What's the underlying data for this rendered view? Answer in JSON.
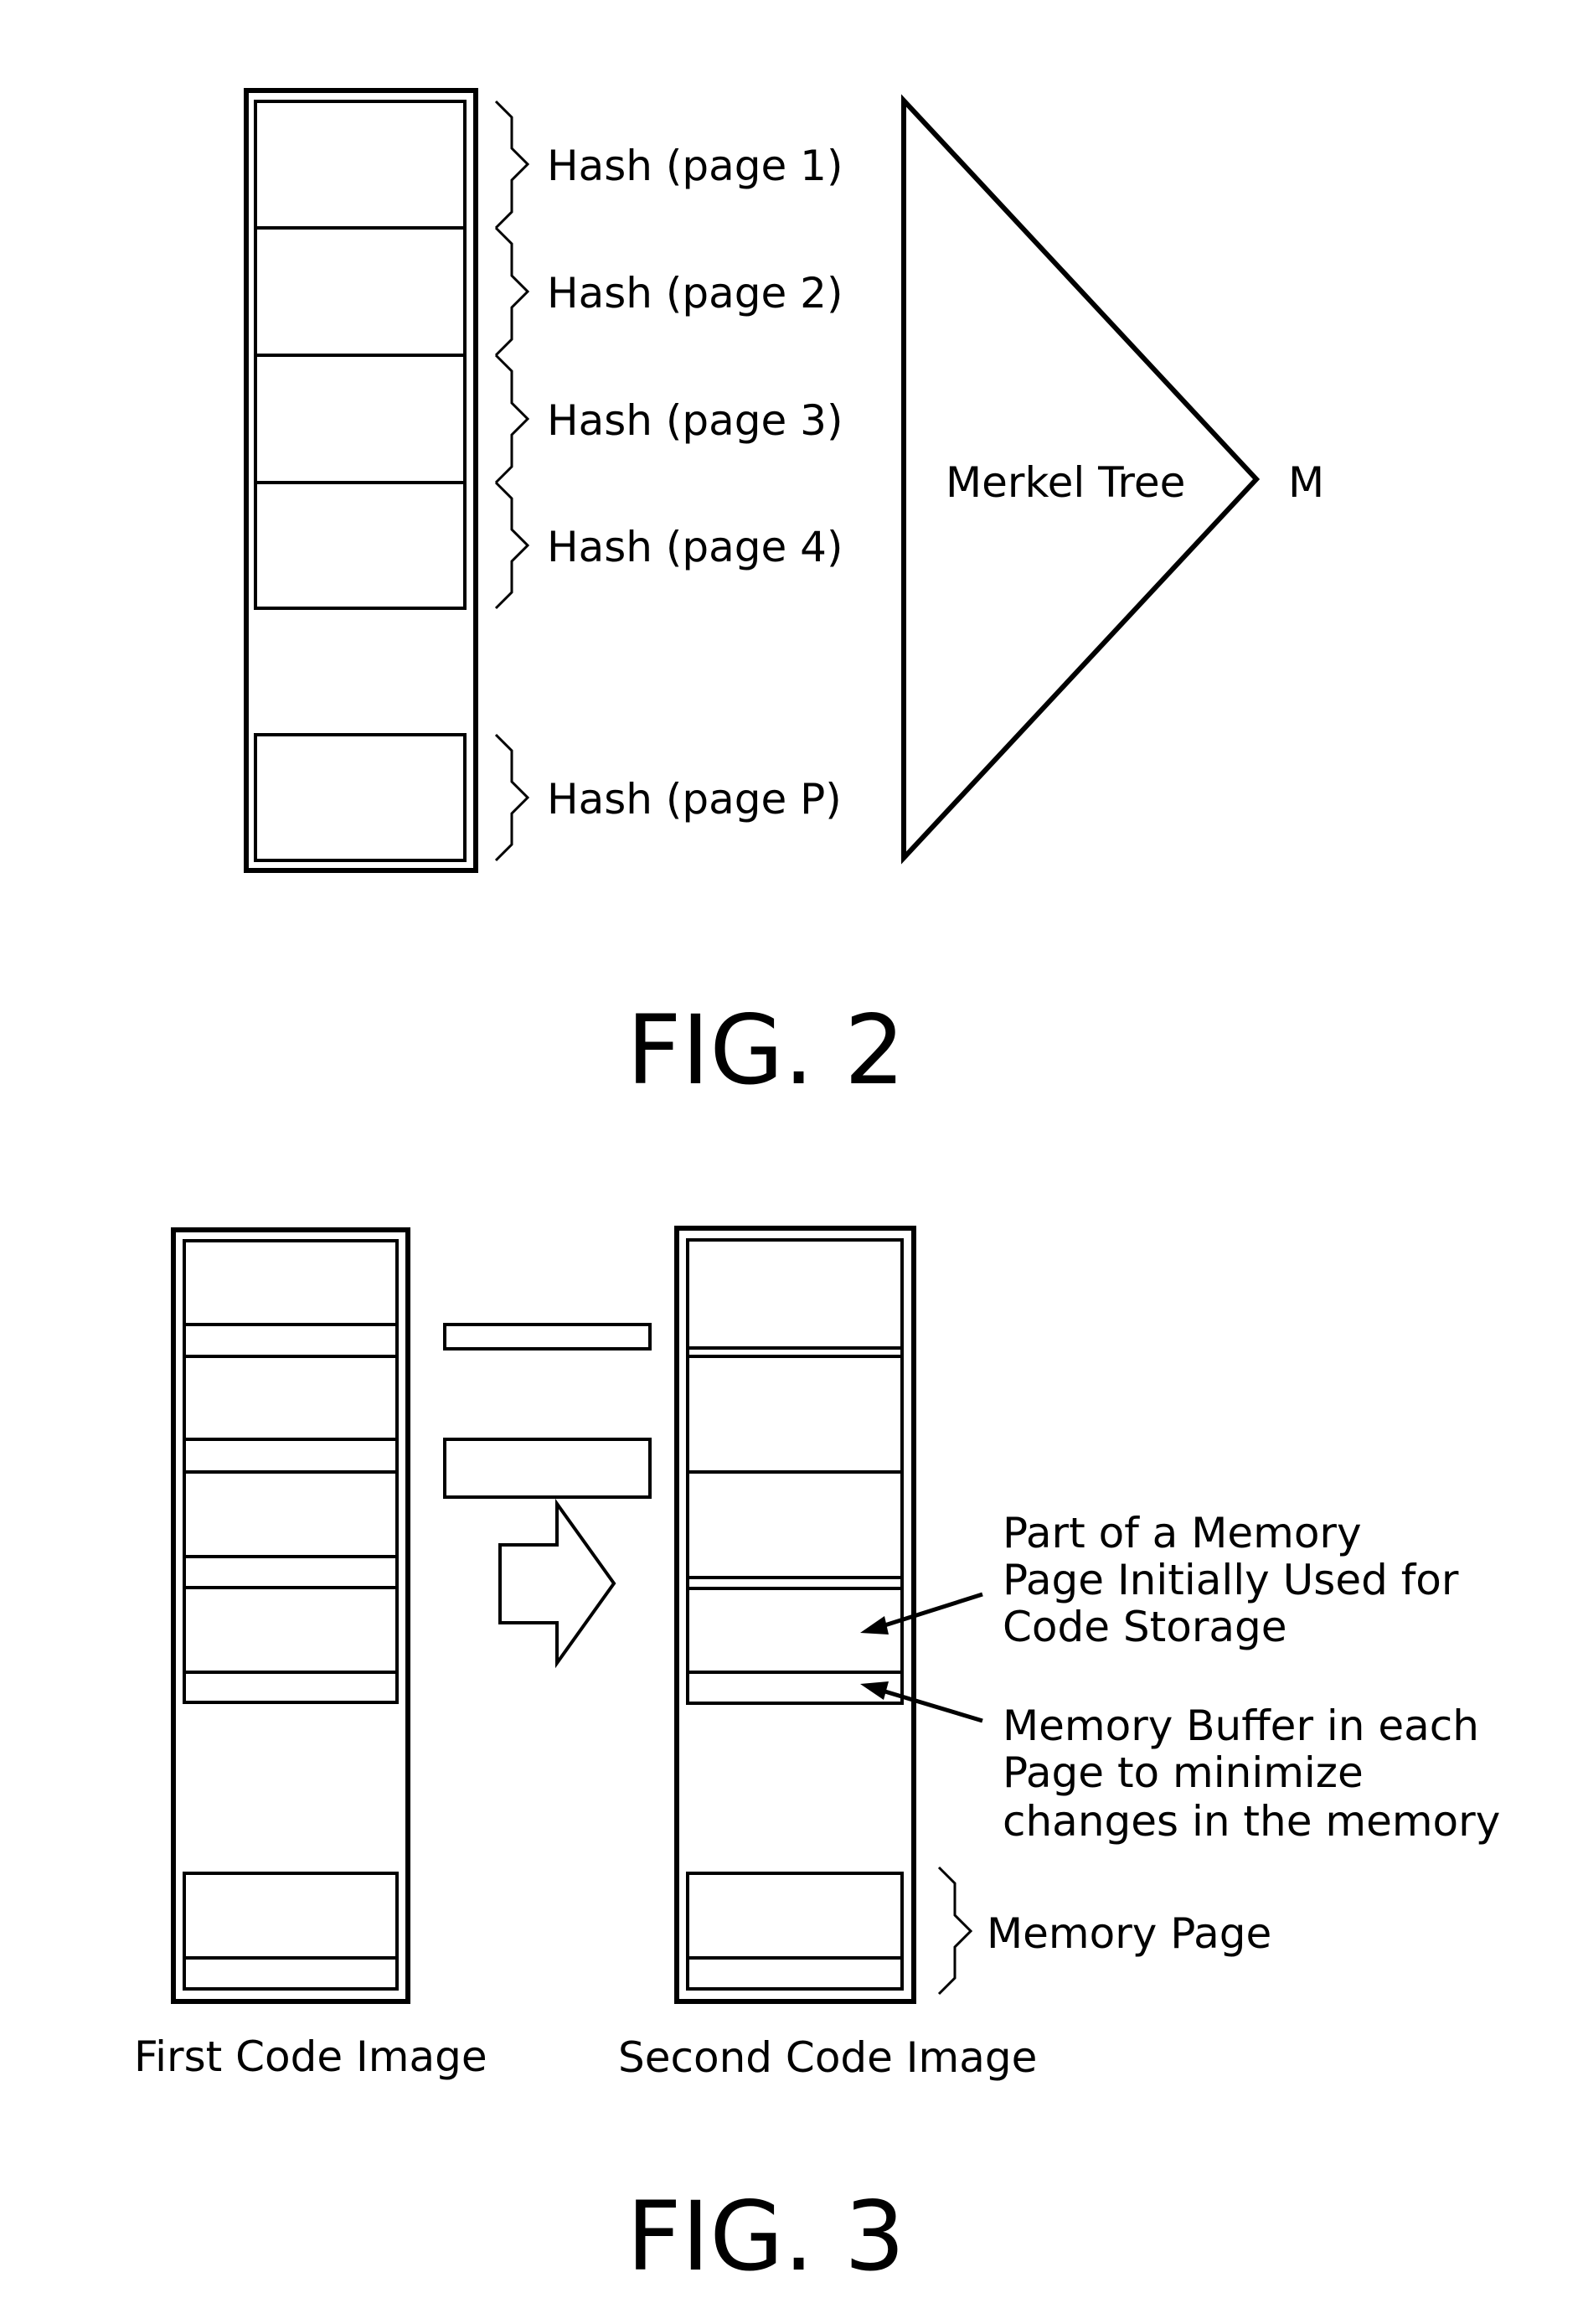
{
  "figure2": {
    "caption": "FIG. 2",
    "hash_labels": [
      "Hash (page 1)",
      "Hash (page 2)",
      "Hash (page 3)",
      "Hash (page 4)",
      "Hash (page P)"
    ],
    "tree_label": "Merkel Tree",
    "root_label": "M"
  },
  "figure3": {
    "caption": "FIG. 3",
    "first_image_label": "First Code Image",
    "second_image_label": "Second Code Image",
    "annotation_code_storage": [
      "Part of a Memory",
      "Page Initially Used for",
      "Code Storage"
    ],
    "annotation_buffer": [
      "Memory Buffer in each",
      "Page to minimize",
      "changes in the memory"
    ],
    "memory_page_label": "Memory Page"
  }
}
